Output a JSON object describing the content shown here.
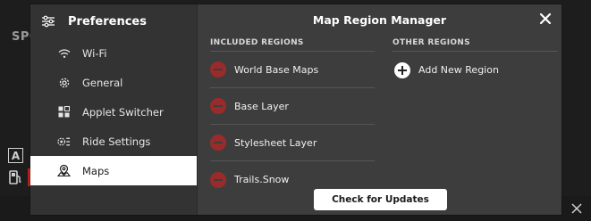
{
  "background": {
    "corner_text": "SPO",
    "a_icon_text": "A"
  },
  "sidebar": {
    "title": "Preferences",
    "items": [
      {
        "label": "Wi-Fi",
        "icon": "wifi-icon"
      },
      {
        "label": "General",
        "icon": "gear-icon"
      },
      {
        "label": "Applet Switcher",
        "icon": "grid-icon"
      },
      {
        "label": "Ride Settings",
        "icon": "ride-settings-icon"
      },
      {
        "label": "Maps",
        "icon": "map-icon",
        "active": true
      }
    ]
  },
  "main": {
    "title": "Map Region Manager",
    "included_header": "INCLUDED REGIONS",
    "other_header": "OTHER REGIONS",
    "included_regions": [
      {
        "name": "World Base Maps"
      },
      {
        "name": "Base Layer"
      },
      {
        "name": "Stylesheet Layer"
      },
      {
        "name": "Trails.Snow"
      }
    ],
    "add_label": "Add New Region",
    "update_button": "Check for Updates"
  },
  "colors": {
    "remove_button": "#9a2b2b",
    "active_item_bg": "#ffffff",
    "dialog_bg": "#3d3d3d"
  }
}
